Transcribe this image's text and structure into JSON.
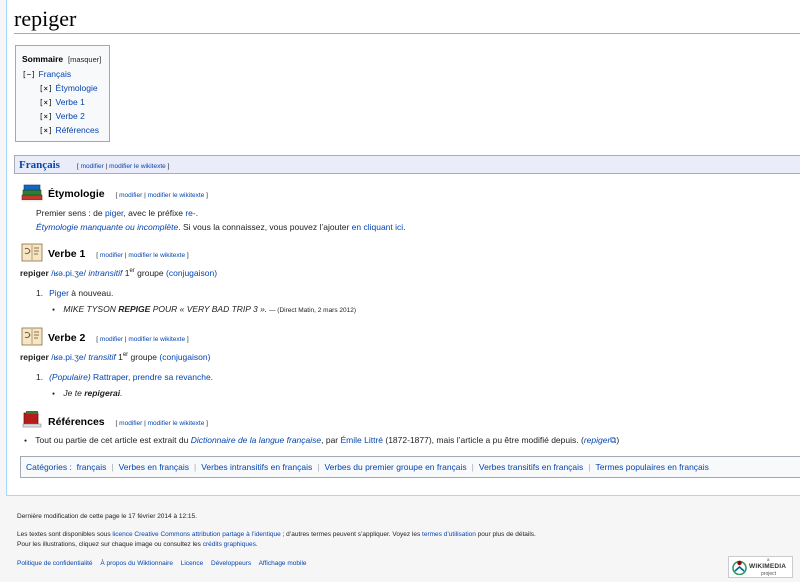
{
  "page": {
    "title": "repiger"
  },
  "toc": {
    "title": "Sommaire",
    "hide": "[masquer]",
    "items": [
      {
        "toggle": "[−]",
        "label": "Français"
      },
      {
        "toggle": "[×]",
        "label": "Étymologie"
      },
      {
        "toggle": "[×]",
        "label": "Verbe 1"
      },
      {
        "toggle": "[×]",
        "label": "Verbe 2"
      },
      {
        "toggle": "[×]",
        "label": "Références"
      }
    ]
  },
  "edit": {
    "open": "[ ",
    "modify": "modifier",
    "sep": " | ",
    "wikitext": "modifier le wikitexte",
    "close": " ]"
  },
  "lang": {
    "title": "Français"
  },
  "etym": {
    "heading": "Étymologie",
    "line1_pre": "Premier sens : de ",
    "line1_link": "piger",
    "line1_mid": ", avec le préfixe ",
    "line1_link2": "re-",
    "line1_end": ".",
    "line2_link": "Étymologie manquante ou incomplète",
    "line2_mid": ". Si vous la connaissez, vous pouvez l’ajouter ",
    "line2_link2": "en cliquant ici",
    "line2_end": "."
  },
  "verb1": {
    "heading": "Verbe 1",
    "word": "repiger",
    "pron": "/ʁə.pi.ʒe/",
    "type": "intransitif",
    "group_num": " 1",
    "group_sup": "er",
    "group_word": " groupe",
    "conj": "(conjugaison)",
    "def_num": "1.",
    "def_link": "Piger",
    "def_rest": " à nouveau.",
    "ex_pre": "MIKE TYSON ",
    "ex_bold": "REPIGE",
    "ex_post": " POUR « VERY BAD TRIP 3 ».",
    "ex_src": " — (Direct Matin, 2 mars 2012)"
  },
  "verb2": {
    "heading": "Verbe 2",
    "word": "repiger",
    "pron": "/ʁə.pi.ʒe/",
    "type": "transitif",
    "group_num": " 1",
    "group_sup": "er",
    "group_word": " groupe",
    "conj": "(conjugaison)",
    "def_num": "1.",
    "def_label": "(Populaire)",
    "def_rest": " Rattraper, prendre sa revanche.",
    "ex_pre": "Je te ",
    "ex_bold": "repigerai",
    "ex_post": "."
  },
  "refs": {
    "heading": "Références",
    "pre": "Tout ou partie de cet article est extrait du ",
    "dict": "Dictionnaire de la langue française",
    "mid": ", par ",
    "author": "Émile Littré",
    "dates": " (1872-1877), mais l’article a pu être modifié depuis. (",
    "src": "repiger",
    "ext_icon": "⧉",
    "end": ")"
  },
  "categories": {
    "label": "Catégories :",
    "items": [
      "français",
      "Verbes en français",
      "Verbes intransitifs en français",
      "Verbes du premier groupe en français",
      "Verbes transitifs en français",
      "Termes populaires en français"
    ]
  },
  "footer": {
    "last_modified": "Dernière modification de cette page le 17 février 2014 à 12:15.",
    "license_pre": "Les textes sont disponibles sous ",
    "license_link": "licence Creative Commons attribution partage à l’identique",
    "license_mid": " ; d’autres termes peuvent s’appliquer. Voyez les ",
    "terms_link": "termes d’utilisation",
    "license_end": " pour plus de détails.",
    "images_pre": "Pour les illustrations, cliquez sur chaque image ou consultez les ",
    "images_link": "crédits graphiques",
    "images_end": ".",
    "links": [
      "Politique de confidentialité",
      "À propos du Wiktionnaire",
      "Licence",
      "Développeurs",
      "Affichage mobile"
    ],
    "badge_small": "a",
    "badge_brand": "WIKIMEDIA",
    "badge_sub": "project"
  },
  "colors": {
    "link": "#0645ad",
    "lang_bar": "#eaecf9",
    "border": "#a2a9b1"
  }
}
